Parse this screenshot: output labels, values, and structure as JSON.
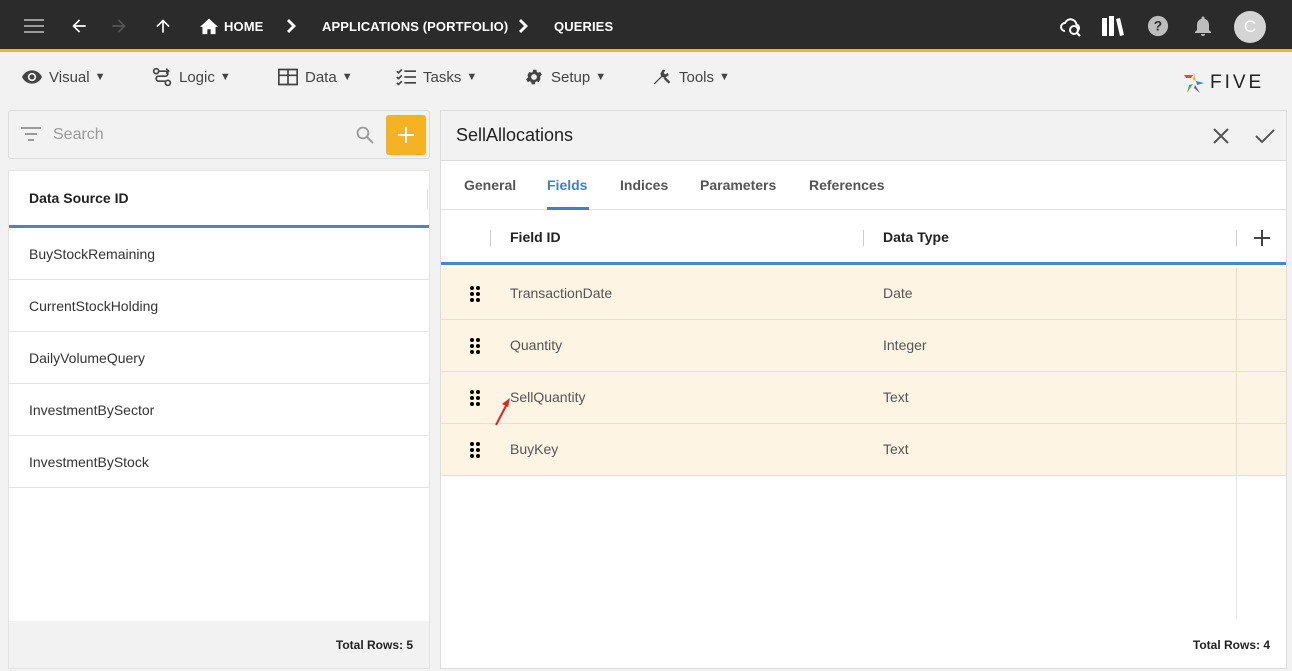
{
  "topbar": {
    "breadcrumbs": [
      "HOME",
      "APPLICATIONS (PORTFOLIO)",
      "QUERIES"
    ],
    "avatar_initial": "C"
  },
  "menu": {
    "items": [
      {
        "label": "Visual",
        "caret": "▼",
        "icon": "eye-icon"
      },
      {
        "label": "Logic",
        "caret": "▼",
        "icon": "logic-icon"
      },
      {
        "label": "Data",
        "caret": "▼",
        "icon": "table-icon"
      },
      {
        "label": "Tasks",
        "caret": "▼",
        "icon": "tasks-icon"
      },
      {
        "label": "Setup",
        "caret": "▼",
        "icon": "gear-icon"
      },
      {
        "label": "Tools",
        "caret": "▼",
        "icon": "tools-icon"
      }
    ]
  },
  "logo": {
    "text": "FIVE"
  },
  "search": {
    "placeholder": "Search",
    "value": ""
  },
  "list": {
    "header": "Data Source ID",
    "rows": [
      "BuyStockRemaining",
      "CurrentStockHolding",
      "DailyVolumeQuery",
      "InvestmentBySector",
      "InvestmentByStock"
    ],
    "footer": "Total Rows: 5"
  },
  "form": {
    "title": "SellAllocations",
    "tabs": [
      "General",
      "Fields",
      "Indices",
      "Parameters",
      "References"
    ],
    "active_tab": "Fields",
    "columns": [
      "Field ID",
      "Data Type"
    ],
    "rows": [
      {
        "field_id": "TransactionDate",
        "data_type": "Date"
      },
      {
        "field_id": "Quantity",
        "data_type": "Integer"
      },
      {
        "field_id": "SellQuantity",
        "data_type": "Text"
      },
      {
        "field_id": "BuyKey",
        "data_type": "Text"
      }
    ],
    "footer": "Total Rows: 4"
  },
  "colors": {
    "accent": "#f5b324",
    "blue": "#3b83c5",
    "row_highlight": "#fdf4e4",
    "topbar": "#2b2b2b",
    "arrow": "#e8211b"
  }
}
